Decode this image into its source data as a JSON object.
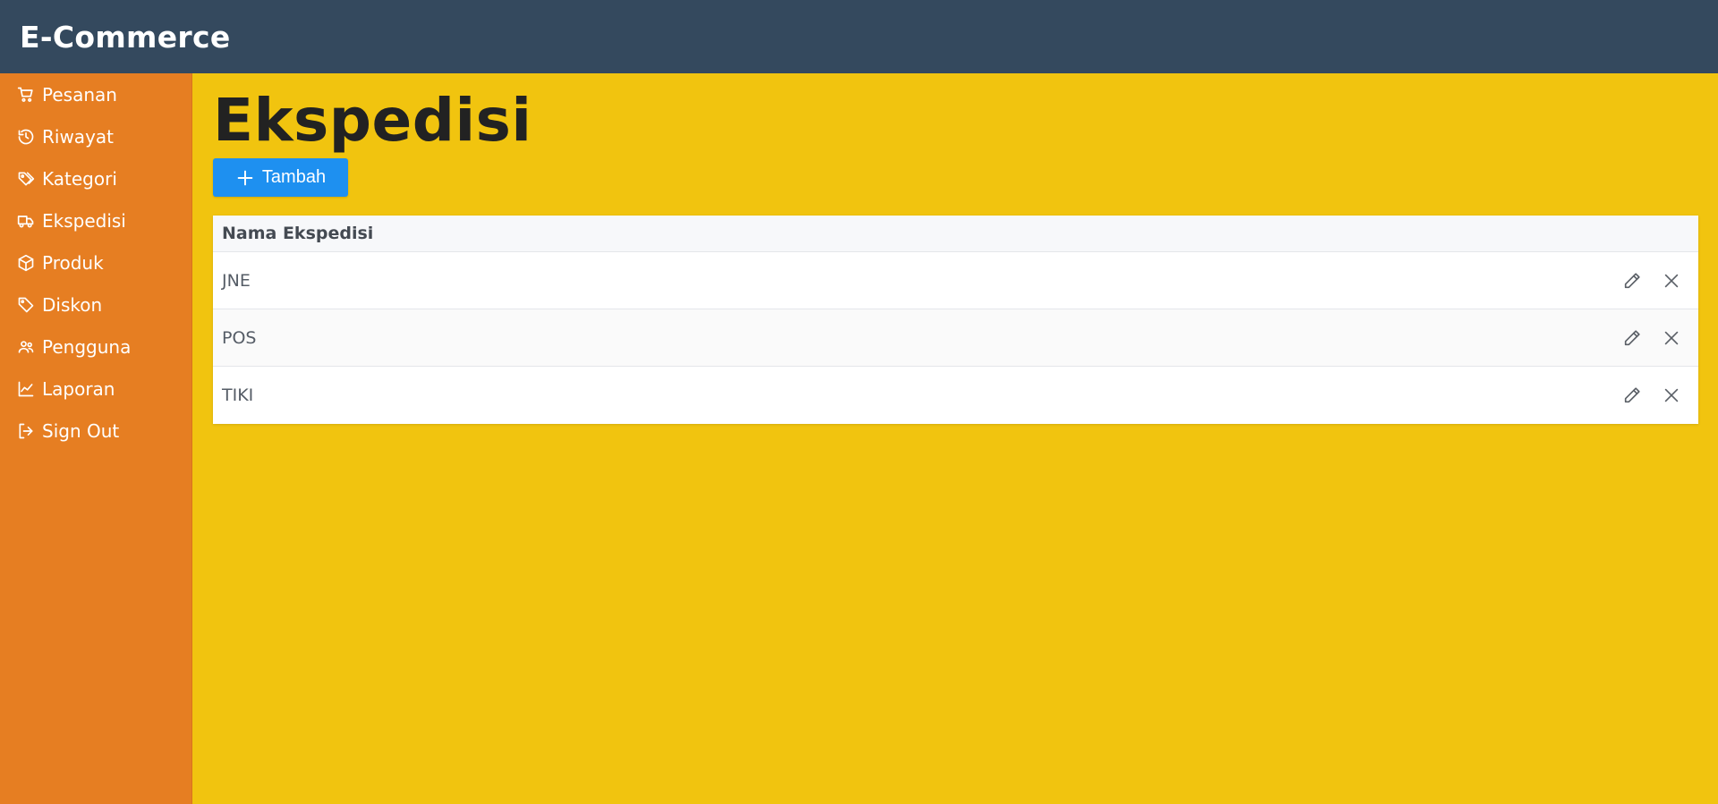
{
  "app": {
    "title": "E-Commerce"
  },
  "sidebar": {
    "items": [
      {
        "label": "Pesanan",
        "icon": "cart-icon"
      },
      {
        "label": "Riwayat",
        "icon": "history-icon"
      },
      {
        "label": "Kategori",
        "icon": "tags-icon"
      },
      {
        "label": "Ekspedisi",
        "icon": "truck-icon"
      },
      {
        "label": "Produk",
        "icon": "box-icon"
      },
      {
        "label": "Diskon",
        "icon": "tag-icon"
      },
      {
        "label": "Pengguna",
        "icon": "users-icon"
      },
      {
        "label": "Laporan",
        "icon": "chart-line-icon"
      },
      {
        "label": "Sign Out",
        "icon": "sign-out-icon"
      }
    ]
  },
  "page": {
    "title": "Ekspedisi",
    "add_button": {
      "label": "Tambah",
      "icon": "plus-icon"
    }
  },
  "table": {
    "header": "Nama Ekspedisi",
    "rows": [
      {
        "name": "JNE"
      },
      {
        "name": "POS"
      },
      {
        "name": "TIKI"
      }
    ],
    "row_actions": [
      "pencil-icon",
      "close-icon"
    ]
  },
  "colors": {
    "topbar": "#34495e",
    "sidebar": "#e67e22",
    "background": "#f1c40f",
    "primary_button": "#1e90f0"
  }
}
